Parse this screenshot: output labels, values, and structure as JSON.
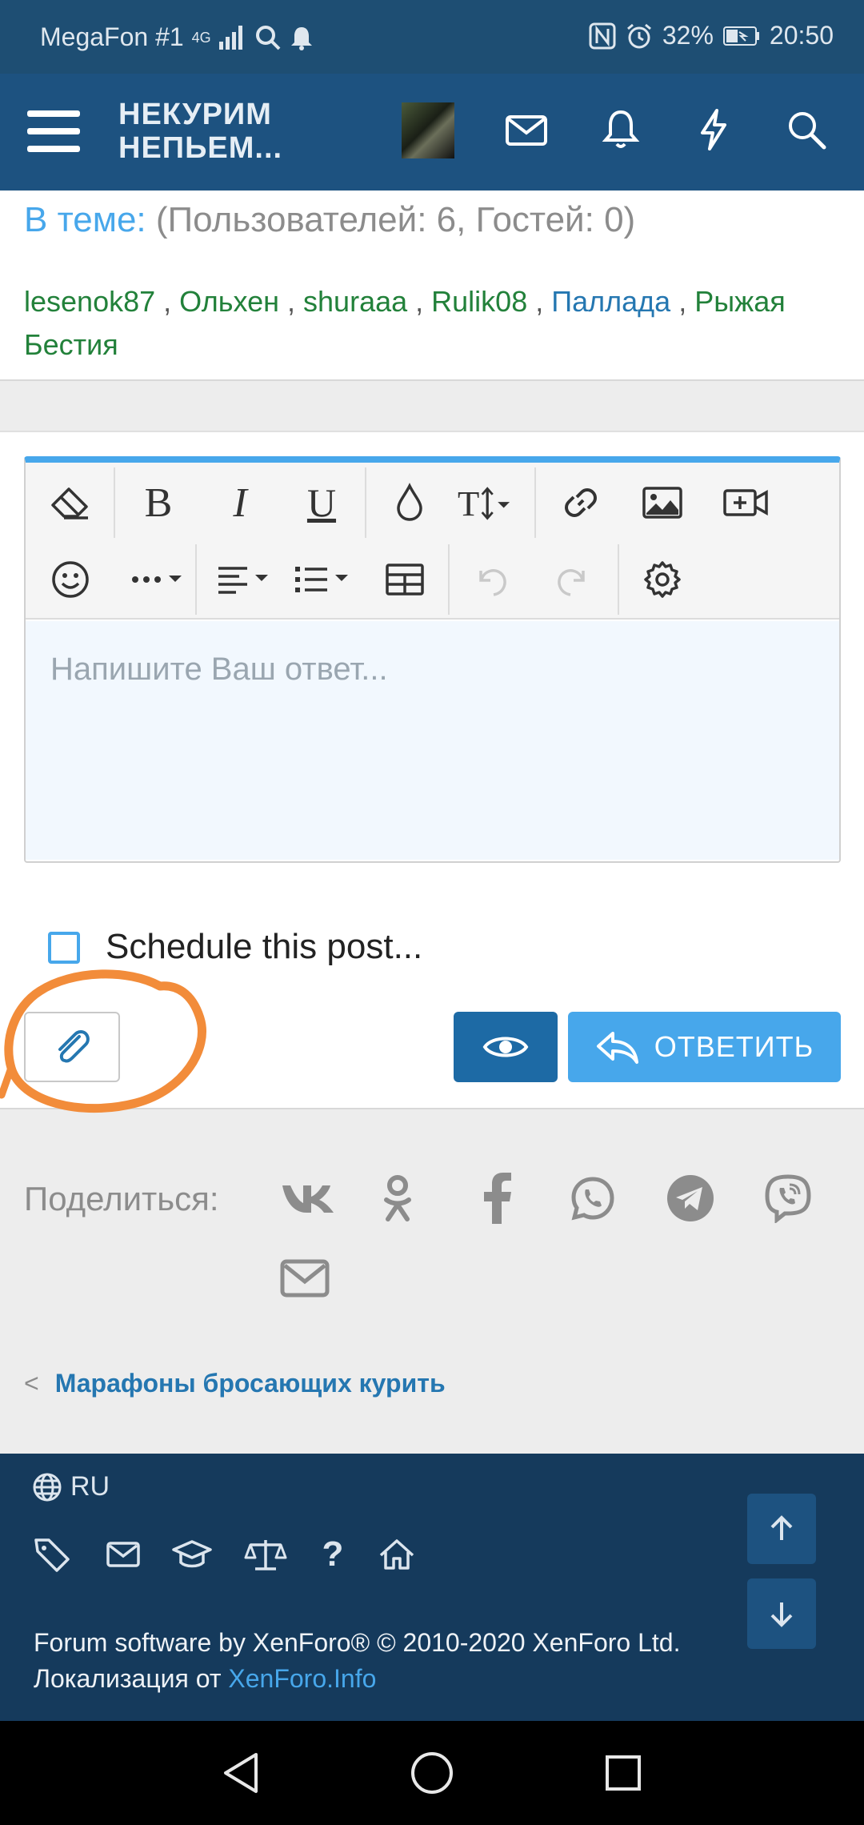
{
  "status_bar": {
    "carrier": "MegaFon #1",
    "network": "4G",
    "battery": "32%",
    "time": "20:50"
  },
  "header": {
    "logo_line1": "НЕКУРИМ",
    "logo_line2": "НЕПЬЕМ..."
  },
  "in_topic": {
    "label": "В теме:",
    "counts": "(Пользователей: 6, Гостей: 0)"
  },
  "users": [
    "lesenok87",
    "Ольхен",
    "shuraaa",
    "Rulik08",
    "Паллада",
    "Рыжая Бестия"
  ],
  "user_separator": " , ",
  "editor": {
    "placeholder": "Напишите Ваш ответ...",
    "toolbar_row1": [
      "eraser-icon",
      "bold-icon",
      "italic-icon",
      "underline-icon",
      "color-drop-icon",
      "font-size-icon",
      "link-icon",
      "image-icon",
      "video-icon"
    ],
    "toolbar_row2": [
      "smile-icon",
      "more-icon",
      "align-icon",
      "list-icon",
      "table-icon",
      "undo-icon",
      "redo-icon",
      "gear-icon"
    ]
  },
  "schedule": {
    "label": "Schedule this post..."
  },
  "actions": {
    "reply_label": "ОТВЕТИТЬ"
  },
  "share": {
    "label": "Поделиться:",
    "networks": [
      "vk-icon",
      "odnoklassniki-icon",
      "facebook-icon",
      "whatsapp-icon",
      "telegram-icon",
      "viber-icon",
      "email-icon"
    ]
  },
  "breadcrumb": {
    "label": "Марафоны бросающих курить"
  },
  "footer": {
    "lang": "RU",
    "copyright_line1": "Forum software by XenForo® © 2010-2020 XenForo Ltd.",
    "localization_prefix": "Локализация от ",
    "localization_link": "XenForo.Info"
  },
  "colors": {
    "header_bg": "#1d5280",
    "footer_bg": "#153a5c",
    "accent": "#47a7eb",
    "button_dark": "#1d6aa5",
    "annotation": "#f28c3a"
  }
}
